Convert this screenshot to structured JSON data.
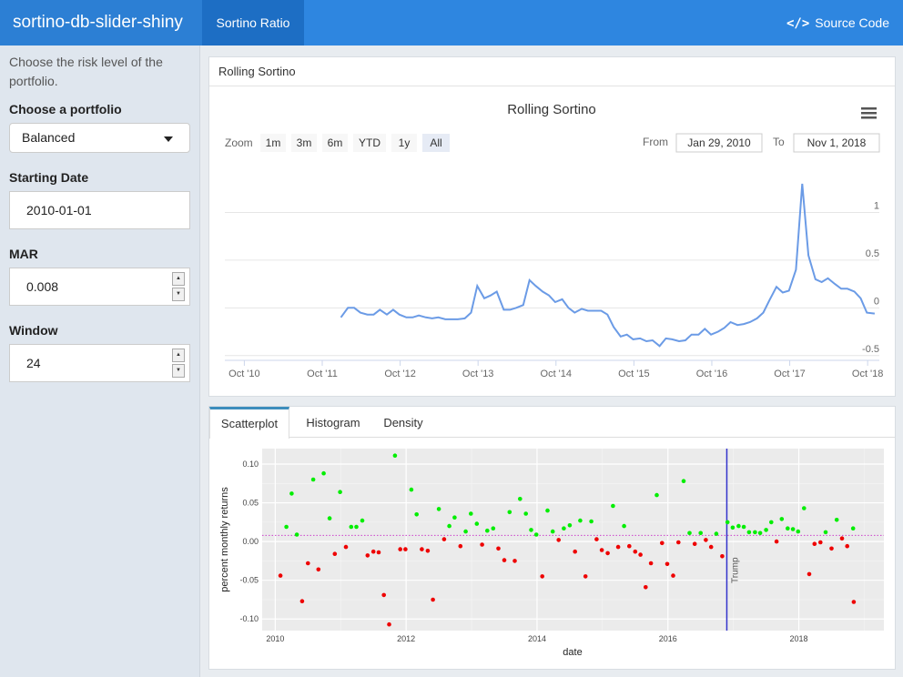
{
  "app": {
    "title": "sortino-db-slider-shiny",
    "nav_tab": "Sortino Ratio",
    "source_code": "Source Code",
    "source_icon": "code-icon"
  },
  "sidebar": {
    "description": "Choose the risk level of the portfolio.",
    "portfolio_label": "Choose a portfolio",
    "portfolio_value": "Balanced",
    "start_label": "Starting Date",
    "start_value": "2010-01-01",
    "mar_label": "MAR",
    "mar_value": "0.008",
    "window_label": "Window",
    "window_value": "24"
  },
  "rolling_box": {
    "header": "Rolling Sortino",
    "zoom_label": "Zoom",
    "zoom_buttons": [
      "1m",
      "3m",
      "6m",
      "YTD",
      "1y",
      "All"
    ],
    "zoom_active": "All",
    "from_label": "From",
    "from_value": "Jan 29, 2010",
    "to_label": "To",
    "to_value": "Nov 1, 2018",
    "menu_icon": "hamburger-menu-icon"
  },
  "tabs": {
    "items": [
      "Scatterplot",
      "Histogram",
      "Density"
    ],
    "active": "Scatterplot"
  },
  "colors": {
    "accent": "#2e86e0",
    "line": "#6b9be6",
    "positive": "#00ee00",
    "negative": "#ee0000",
    "vline": "#3333cc"
  },
  "chart_data": [
    {
      "type": "line",
      "title": "Rolling Sortino",
      "x_ticks": [
        "Oct '10",
        "Oct '11",
        "Oct '12",
        "Oct '13",
        "Oct '14",
        "Oct '15",
        "Oct '16",
        "Oct '17",
        "Oct '18"
      ],
      "y_ticks": [
        "1",
        "0.5",
        "0",
        "-0.5"
      ],
      "ylim": [
        -0.55,
        1.5
      ],
      "xlim": [
        2010.5,
        2018.9
      ],
      "grid": true,
      "series": [
        {
          "x": [
            2011.99,
            2012.08,
            2012.16,
            2012.24,
            2012.33,
            2012.41,
            2012.49,
            2012.58,
            2012.66,
            2012.74,
            2012.83,
            2012.91,
            2012.99,
            2013.08,
            2013.16,
            2013.24,
            2013.33,
            2013.41,
            2013.49,
            2013.58,
            2013.66,
            2013.74,
            2013.83,
            2013.91,
            2013.99,
            2014.08,
            2014.16,
            2014.24,
            2014.33,
            2014.41,
            2014.49,
            2014.58,
            2014.66,
            2014.74,
            2014.83,
            2014.91,
            2014.99,
            2015.08,
            2015.16,
            2015.24,
            2015.33,
            2015.41,
            2015.49,
            2015.58,
            2015.66,
            2015.74,
            2015.83,
            2015.91,
            2015.99,
            2016.08,
            2016.16,
            2016.24,
            2016.33,
            2016.41,
            2016.49,
            2016.58,
            2016.66,
            2016.74,
            2016.83,
            2016.91,
            2016.99,
            2017.08,
            2017.16,
            2017.24,
            2017.33,
            2017.41,
            2017.49,
            2017.58,
            2017.66,
            2017.74,
            2017.83,
            2017.91,
            2017.99,
            2018.08,
            2018.16,
            2018.24,
            2018.33,
            2018.41,
            2018.49,
            2018.58,
            2018.66,
            2018.74,
            2018.84
          ],
          "y": [
            -0.1,
            0.0,
            0.0,
            -0.05,
            -0.07,
            -0.07,
            -0.02,
            -0.07,
            -0.02,
            -0.07,
            -0.1,
            -0.1,
            -0.08,
            -0.1,
            -0.11,
            -0.1,
            -0.12,
            -0.12,
            -0.12,
            -0.11,
            -0.05,
            0.23,
            0.1,
            0.13,
            0.17,
            -0.02,
            -0.02,
            0.0,
            0.03,
            0.29,
            0.23,
            0.17,
            0.13,
            0.06,
            0.09,
            0.0,
            -0.05,
            -0.01,
            -0.03,
            -0.03,
            -0.03,
            -0.07,
            -0.2,
            -0.3,
            -0.28,
            -0.33,
            -0.32,
            -0.35,
            -0.34,
            -0.4,
            -0.32,
            -0.33,
            -0.35,
            -0.34,
            -0.28,
            -0.28,
            -0.22,
            -0.28,
            -0.25,
            -0.21,
            -0.15,
            -0.18,
            -0.17,
            -0.15,
            -0.11,
            -0.05,
            0.08,
            0.22,
            0.16,
            0.18,
            0.4,
            1.3,
            0.55,
            0.3,
            0.27,
            0.31,
            0.25,
            0.2,
            0.2,
            0.17,
            0.1,
            -0.05,
            -0.06
          ]
        }
      ]
    },
    {
      "type": "scatter",
      "xlabel": "date",
      "ylabel": "percent monthly returns",
      "x_ticks": [
        "2010",
        "2012",
        "2014",
        "2016",
        "2018"
      ],
      "y_ticks": [
        "0.10",
        "0.05",
        "0.00",
        "-0.05",
        "-0.10"
      ],
      "xlim": [
        2009.8,
        2019.3
      ],
      "ylim": [
        -0.115,
        0.12
      ],
      "hline": 0.008,
      "vline": {
        "x": 2016.9,
        "label": "Trump"
      },
      "points": [
        [
          2010.08,
          -0.044
        ],
        [
          2010.17,
          0.019
        ],
        [
          2010.25,
          0.062
        ],
        [
          2010.33,
          0.009
        ],
        [
          2010.41,
          -0.077
        ],
        [
          2010.5,
          -0.028
        ],
        [
          2010.58,
          0.08
        ],
        [
          2010.66,
          -0.036
        ],
        [
          2010.74,
          0.088
        ],
        [
          2010.83,
          0.03
        ],
        [
          2010.91,
          -0.016
        ],
        [
          2010.99,
          0.064
        ],
        [
          2011.08,
          -0.007
        ],
        [
          2011.16,
          0.019
        ],
        [
          2011.24,
          0.019
        ],
        [
          2011.33,
          0.027
        ],
        [
          2011.41,
          -0.018
        ],
        [
          2011.5,
          -0.013
        ],
        [
          2011.58,
          -0.014
        ],
        [
          2011.66,
          -0.069
        ],
        [
          2011.74,
          -0.107
        ],
        [
          2011.83,
          0.111
        ],
        [
          2011.91,
          -0.01
        ],
        [
          2011.99,
          -0.01
        ],
        [
          2012.08,
          0.067
        ],
        [
          2012.16,
          0.035
        ],
        [
          2012.24,
          -0.01
        ],
        [
          2012.33,
          -0.012
        ],
        [
          2012.41,
          -0.075
        ],
        [
          2012.5,
          0.042
        ],
        [
          2012.58,
          0.003
        ],
        [
          2012.66,
          0.02
        ],
        [
          2012.74,
          0.031
        ],
        [
          2012.83,
          -0.006
        ],
        [
          2012.91,
          0.013
        ],
        [
          2012.99,
          0.036
        ],
        [
          2013.08,
          0.023
        ],
        [
          2013.16,
          -0.004
        ],
        [
          2013.24,
          0.014
        ],
        [
          2013.33,
          0.017
        ],
        [
          2013.41,
          -0.009
        ],
        [
          2013.5,
          -0.024
        ],
        [
          2013.58,
          0.038
        ],
        [
          2013.66,
          -0.025
        ],
        [
          2013.74,
          0.055
        ],
        [
          2013.83,
          0.036
        ],
        [
          2013.91,
          0.015
        ],
        [
          2013.99,
          0.009
        ],
        [
          2014.08,
          -0.045
        ],
        [
          2014.16,
          0.04
        ],
        [
          2014.24,
          0.013
        ],
        [
          2014.33,
          0.002
        ],
        [
          2014.41,
          0.017
        ],
        [
          2014.5,
          0.021
        ],
        [
          2014.58,
          -0.013
        ],
        [
          2014.66,
          0.027
        ],
        [
          2014.74,
          -0.045
        ],
        [
          2014.83,
          0.026
        ],
        [
          2014.91,
          0.003
        ],
        [
          2014.99,
          -0.011
        ],
        [
          2015.08,
          -0.015
        ],
        [
          2015.16,
          0.046
        ],
        [
          2015.24,
          -0.007
        ],
        [
          2015.33,
          0.02
        ],
        [
          2015.41,
          -0.006
        ],
        [
          2015.5,
          -0.013
        ],
        [
          2015.58,
          -0.017
        ],
        [
          2015.66,
          -0.059
        ],
        [
          2015.74,
          -0.028
        ],
        [
          2015.83,
          0.06
        ],
        [
          2015.91,
          -0.002
        ],
        [
          2015.99,
          -0.029
        ],
        [
          2016.08,
          -0.044
        ],
        [
          2016.16,
          -0.001
        ],
        [
          2016.24,
          0.078
        ],
        [
          2016.33,
          0.011
        ],
        [
          2016.41,
          -0.003
        ],
        [
          2016.5,
          0.011
        ],
        [
          2016.58,
          0.002
        ],
        [
          2016.66,
          -0.007
        ],
        [
          2016.74,
          0.01
        ],
        [
          2016.83,
          -0.019
        ],
        [
          2016.91,
          0.025
        ],
        [
          2016.99,
          0.018
        ],
        [
          2017.08,
          0.02
        ],
        [
          2017.16,
          0.019
        ],
        [
          2017.24,
          0.012
        ],
        [
          2017.33,
          0.012
        ],
        [
          2017.41,
          0.011
        ],
        [
          2017.5,
          0.015
        ],
        [
          2017.58,
          0.025
        ],
        [
          2017.66,
          0.0
        ],
        [
          2017.74,
          0.029
        ],
        [
          2017.83,
          0.017
        ],
        [
          2017.91,
          0.016
        ],
        [
          2017.99,
          0.013
        ],
        [
          2018.08,
          0.043
        ],
        [
          2018.16,
          -0.042
        ],
        [
          2018.24,
          -0.003
        ],
        [
          2018.33,
          -0.001
        ],
        [
          2018.41,
          0.012
        ],
        [
          2018.5,
          -0.009
        ],
        [
          2018.58,
          0.028
        ],
        [
          2018.66,
          0.004
        ],
        [
          2018.74,
          -0.006
        ],
        [
          2018.83,
          0.017
        ],
        [
          2018.84,
          -0.078
        ]
      ]
    }
  ]
}
